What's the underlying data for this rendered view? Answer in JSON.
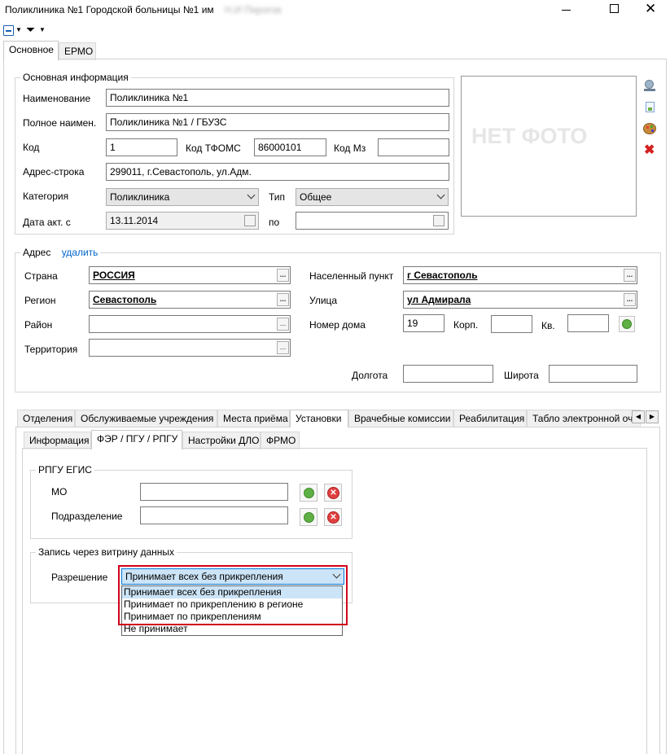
{
  "window": {
    "title": "Поликлиника №1 Городской больницы №1 им",
    "title_blurred": "Н.И Пирогов"
  },
  "main_tabs": [
    "Основное",
    "ЕРМО"
  ],
  "photo_placeholder": "НЕТ ФОТО",
  "basic": {
    "group_title": "Основная информация",
    "name_label": "Наименование",
    "name_value": "Поликлиника №1",
    "fullname_label": "Полное наимен.",
    "fullname_value": "Поликлиника №1 / ГБУЗС",
    "code_label": "Код",
    "code_value": "1",
    "tfoms_label": "Код ТФОМС",
    "tfoms_value": "86000101",
    "mz_label": "Код Мз",
    "mz_value": "",
    "addr_label": "Адрес-строка",
    "addr_value": "299011, г.Севастополь, ул.Адм.",
    "category_label": "Категория",
    "category_value": "Поликлиника",
    "type_label": "Тип",
    "type_value": "Общее",
    "date_label": "Дата акт. с",
    "date_value": "13.11.2014",
    "to_label": "по",
    "to_value": ""
  },
  "address": {
    "group_title": "Адрес",
    "delete_link": "удалить",
    "country_label": "Страна",
    "country_value": "РОССИЯ",
    "region_label": "Регион",
    "region_value": "Севастополь",
    "district_label": "Район",
    "district_value": "",
    "territory_label": "Территория",
    "territory_value": "",
    "settlement_label": "Населенный пункт",
    "settlement_value": "г Севастополь",
    "street_label": "Улица",
    "street_value": "ул Адмирала",
    "house_label": "Номер дома",
    "house_value": "19",
    "building_label": "Корп.",
    "building_value": "",
    "apt_label": "Кв.",
    "apt_value": "",
    "lon_label": "Долгота",
    "lon_value": "",
    "lat_label": "Широта",
    "lat_value": ""
  },
  "section_tabs": [
    "Отделения",
    "Обслуживаемые учреждения",
    "Места приёма",
    "Установки",
    "Врачебные комиссии",
    "Реабилитация",
    "Табло электронной оч"
  ],
  "sub_tabs": [
    "Информация",
    "ФЭР / ПГУ / РПГУ",
    "Настройки ДЛО",
    "ФРМО"
  ],
  "rpgu": {
    "group_title": "РПГУ ЕГИС",
    "mo_label": "МО",
    "mo_value": "",
    "sub_label": "Подразделение",
    "sub_value": ""
  },
  "vitrina": {
    "group_title": "Запись через витрину данных",
    "perm_label": "Разрешение",
    "perm_value": "Принимает всех без прикрепления",
    "options": [
      "Принимает всех без прикрепления",
      "Принимает по прикреплению в регионе",
      "Принимает по прикреплениям",
      "Не принимает"
    ]
  },
  "colors": {
    "highlight_border": "#d0021b",
    "link": "#0066cc",
    "option_highlight": "#cce4f7"
  }
}
